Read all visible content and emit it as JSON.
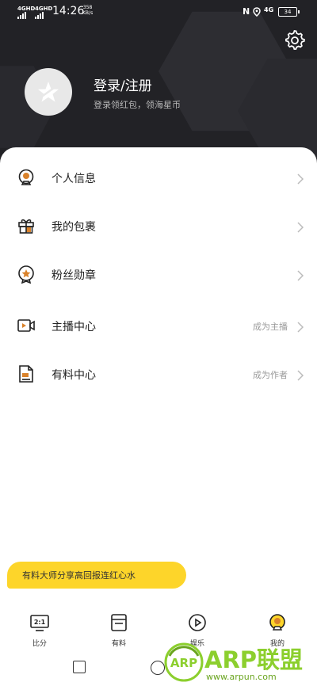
{
  "status_bar": {
    "sim1": "4GHD",
    "sim2": "4GHD",
    "time": "14:26",
    "speed_value": "358",
    "speed_unit": "KB/s",
    "nfc": "N",
    "network": "4G",
    "battery": "34"
  },
  "profile": {
    "title": "登录/注册",
    "subtitle": "登录领红包，领海星币"
  },
  "menu": [
    {
      "label": "个人信息",
      "hint": "",
      "icon": "person-info-icon"
    },
    {
      "label": "我的包裹",
      "hint": "",
      "icon": "gift-icon"
    },
    {
      "label": "粉丝勋章",
      "hint": "",
      "icon": "medal-icon"
    },
    {
      "label": "主播中心",
      "hint": "成为主播",
      "icon": "video-camera-icon"
    },
    {
      "label": "有料中心",
      "hint": "成为作者",
      "icon": "document-icon"
    }
  ],
  "banner": {
    "text": "有料大师分享高回报连红心水"
  },
  "tabs": [
    {
      "label": "比分",
      "icon_text": "2:1",
      "icon": "score-icon"
    },
    {
      "label": "有料",
      "icon": "article-icon"
    },
    {
      "label": "娱乐",
      "icon": "play-icon"
    },
    {
      "label": "我的",
      "icon": "profile-icon"
    }
  ],
  "watermark": {
    "logo": "ARP",
    "title": "ARP联盟",
    "url": "www.arpun.com"
  },
  "colors": {
    "header_bg": "#222226",
    "accent_yellow": "#fdd52a",
    "icon_orange": "#d9822b",
    "watermark_green": "#8ccf2e"
  }
}
